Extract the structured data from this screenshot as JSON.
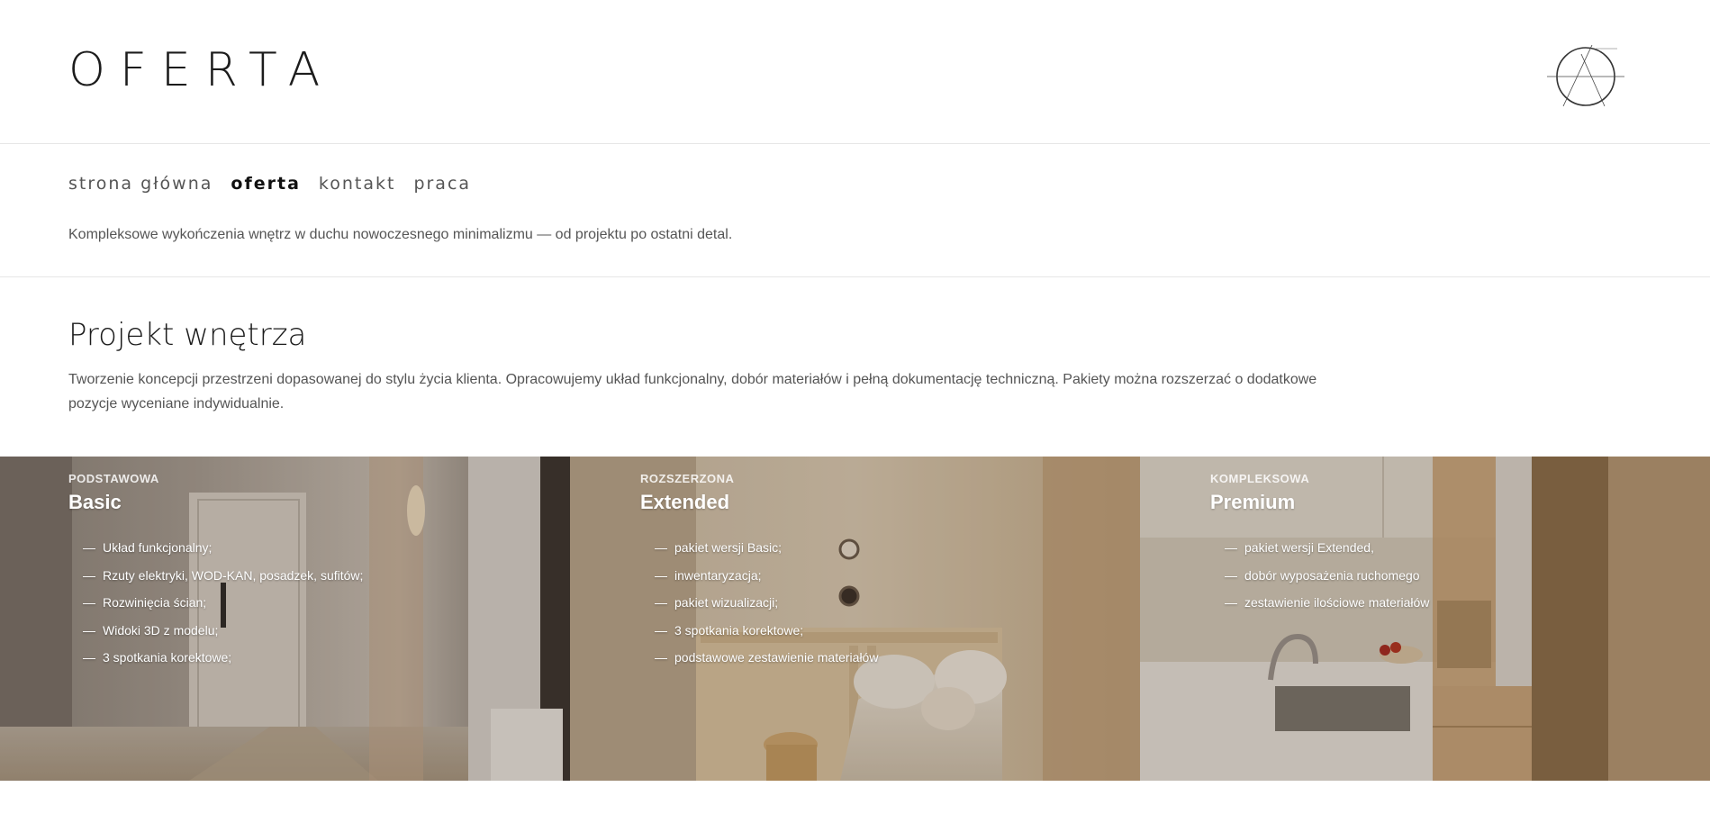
{
  "header": {
    "title": "OFERTA"
  },
  "nav": {
    "items": [
      {
        "label": "strona główna"
      },
      {
        "label": "oferta"
      },
      {
        "label": "kontakt"
      },
      {
        "label": "praca"
      }
    ],
    "active": "oferta"
  },
  "tagline": "Kompleksowe wykończenia wnętrz w duchu nowoczesnego minimalizmu — od projektu po ostatni detal.",
  "section": {
    "title": "Projekt wnętrza",
    "description": "Tworzenie koncepcji przestrzeni dopasowanej do stylu życia klienta. Opracowujemy układ funkcjonalny, dobór materiałów i pełną dokumentację techniczną. Pakiety można rozszerzać o dodatkowe pozycje wyceniane indywidualnie."
  },
  "packages": [
    {
      "kicker": "PODSTAWOWA",
      "name": "Basic",
      "items": [
        "Układ funkcjonalny;",
        "Rzuty elektryki, WOD-KAN, posadzek, sufitów;",
        "Rozwinięcia ścian;",
        "Widoki 3D z modelu;",
        "3 spotkania korektowe;"
      ]
    },
    {
      "kicker": "ROZSZERZONA",
      "name": "Extended",
      "items": [
        "pakiet wersji Basic;",
        "inwentaryzacja;",
        "pakiet wizualizacji;",
        "3 spotkania korektowe;",
        "podstawowe zestawienie materiałów"
      ]
    },
    {
      "kicker": "KOMPLEKSOWA",
      "name": "Premium",
      "items": [
        "pakiet wersji Extended,",
        "dobór wyposażenia ruchomego",
        "zestawienie ilościowe materiałów"
      ]
    }
  ],
  "icons": {
    "logo": "logo-monogram-icon",
    "list_marker": "—"
  }
}
